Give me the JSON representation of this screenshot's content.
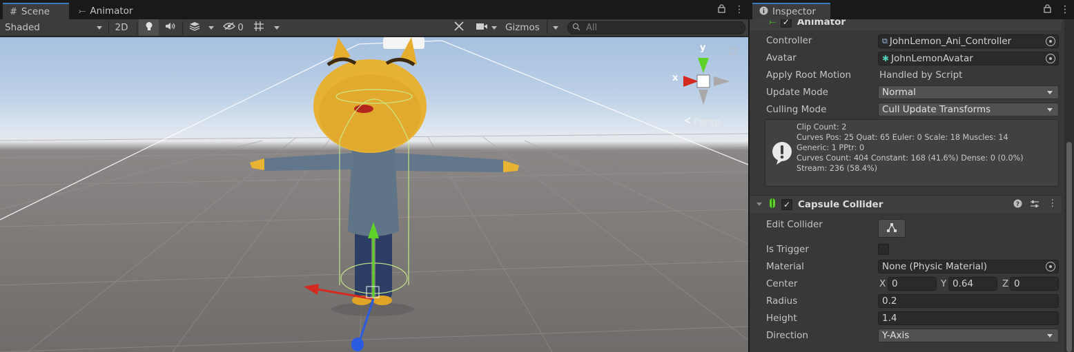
{
  "scene": {
    "tabs": [
      {
        "label": "Scene",
        "icon": "grid-icon"
      },
      {
        "label": "Animator",
        "icon": "animator-icon"
      }
    ],
    "toolbar": {
      "draw_mode": "Shaded",
      "mode_2d": "2D",
      "hidden_count": "0",
      "gizmos_label": "Gizmos",
      "search_placeholder": "All"
    },
    "gizmo": {
      "y": "y",
      "x": "x",
      "projection": "Persp"
    }
  },
  "inspector": {
    "tab_label": "Inspector",
    "animator": {
      "title": "Animator",
      "controller_label": "Controller",
      "controller_value": "JohnLemon_Ani_Controller",
      "avatar_label": "Avatar",
      "avatar_value": "JohnLemonAvatar",
      "root_motion_label": "Apply Root Motion",
      "root_motion_value": "Handled by Script",
      "update_mode_label": "Update Mode",
      "update_mode_value": "Normal",
      "culling_mode_label": "Culling Mode",
      "culling_mode_value": "Cull Update Transforms",
      "info_lines": [
        "Clip Count: 2",
        "Curves Pos: 25 Quat: 65 Euler: 0 Scale: 18 Muscles: 14",
        "Generic: 1 PPtr: 0",
        "Curves Count: 404 Constant: 168 (41.6%) Dense: 0 (0.0%)",
        "Stream: 236 (58.4%)"
      ]
    },
    "capsule_collider": {
      "title": "Capsule Collider",
      "edit_collider_label": "Edit Collider",
      "is_trigger_label": "Is Trigger",
      "material_label": "Material",
      "material_value": "None (Physic Material)",
      "center_label": "Center",
      "center_x_label": "X",
      "center_x": "0",
      "center_y_label": "Y",
      "center_y": "0.64",
      "center_z_label": "Z",
      "center_z": "0",
      "radius_label": "Radius",
      "radius_value": "0.2",
      "height_label": "Height",
      "height_value": "1.4",
      "direction_label": "Direction",
      "direction_value": "Y-Axis"
    }
  },
  "colors": {
    "accent": "#3a79bb",
    "axis_x": "#d42a20",
    "axis_y": "#5ed12a",
    "axis_z": "#2a5be0",
    "character_yellow": "#e8b233"
  }
}
